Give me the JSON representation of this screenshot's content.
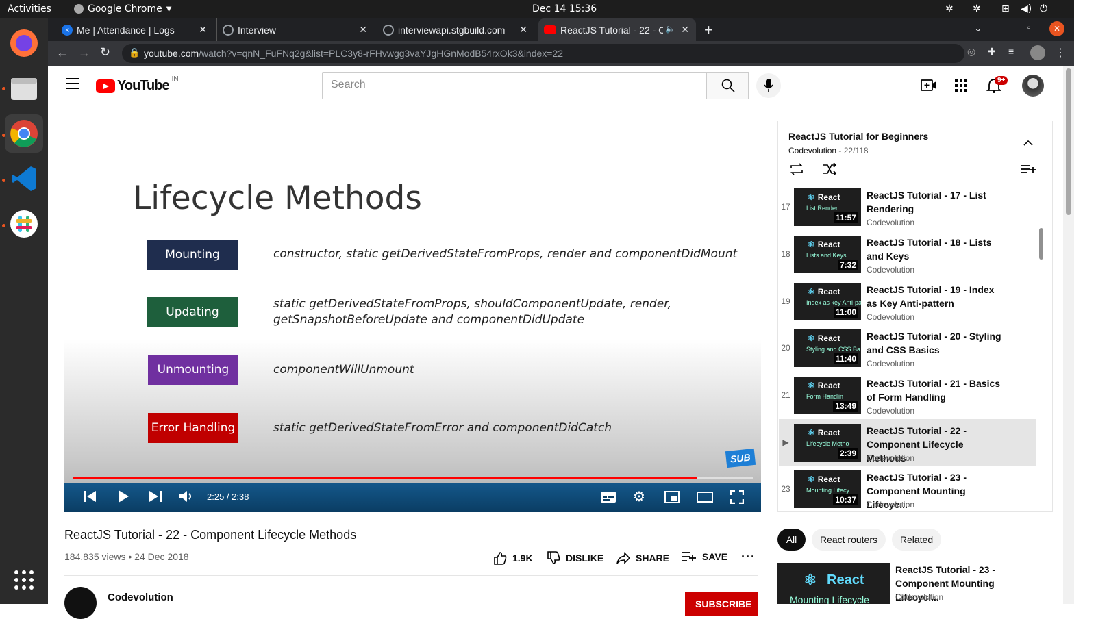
{
  "system": {
    "activities": "Activities",
    "app_name": "Google Chrome",
    "clock": "Dec 14  15:36"
  },
  "tabs": [
    {
      "title": "Me | Attendance | Logs",
      "fav_color": "#1a73e8",
      "fav_letter": "k"
    },
    {
      "title": "Interview",
      "fav_color": "#5f6368",
      "fav_letter": ""
    },
    {
      "title": "interviewapi.stgbuild.com",
      "fav_color": "#5f6368",
      "fav_letter": ""
    },
    {
      "title": "ReactJS Tutorial - 22 - C",
      "fav_color": "#ff0000",
      "fav_letter": ""
    }
  ],
  "address": {
    "domain": "youtube.com",
    "path": "/watch?v=qnN_FuFNq2g&list=PLC3y8-rFHvwgg3vaYJgHGnModB54rxOk3&index=22"
  },
  "masthead": {
    "logo_text": "YouTube",
    "region": "IN",
    "search_placeholder": "Search",
    "notif_count": "9+"
  },
  "slide": {
    "title": "Lifecycle Methods",
    "rows": [
      {
        "label": "Mounting",
        "color": "#1f2d4e",
        "desc_line1": "constructor, static getDerivedStateFromProps, render and componentDidMount",
        "desc_line2": ""
      },
      {
        "label": "Updating",
        "color": "#1e5f3c",
        "desc_line1": "static getDerivedStateFromProps, shouldComponentUpdate, render,",
        "desc_line2": "getSnapshotBeforeUpdate and componentDidUpdate"
      },
      {
        "label": "Unmounting",
        "color": "#7030a0",
        "desc_line1": "componentWillUnmount",
        "desc_line2": ""
      },
      {
        "label": "Error Handling",
        "color": "#c00000",
        "desc_line1": "static getDerivedStateFromError and componentDidCatch",
        "desc_line2": ""
      }
    ],
    "sub_badge": "SUB"
  },
  "player": {
    "time": "2:25 / 2:38",
    "progress": 0.917
  },
  "video": {
    "title": "ReactJS Tutorial - 22 - Component Lifecycle Methods",
    "meta": "184,835 views • 24 Dec 2018",
    "likes": "1.9K",
    "dislike": "DISLIKE",
    "share": "SHARE",
    "save": "SAVE",
    "channel": "Codevolution",
    "subscribe": "SUBSCRIBE"
  },
  "playlist": {
    "title": "ReactJS Tutorial for Beginners",
    "channel": "Codevolution",
    "position": "22/118",
    "items": [
      {
        "num": "17",
        "title": "ReactJS Tutorial - 17 - List Rendering",
        "channel": "Codevolution",
        "duration": "11:57",
        "thumb_sub": "List Render"
      },
      {
        "num": "18",
        "title": "ReactJS Tutorial - 18 - Lists and Keys",
        "channel": "Codevolution",
        "duration": "7:32",
        "thumb_sub": "Lists and Keys"
      },
      {
        "num": "19",
        "title": "ReactJS Tutorial - 19 - Index as Key Anti-pattern",
        "channel": "Codevolution",
        "duration": "11:00",
        "thumb_sub": "Index as key Anti-pa"
      },
      {
        "num": "20",
        "title": "ReactJS Tutorial - 20 - Styling and CSS Basics",
        "channel": "Codevolution",
        "duration": "11:40",
        "thumb_sub": "Styling and CSS Ba"
      },
      {
        "num": "21",
        "title": "ReactJS Tutorial - 21 - Basics of Form Handling",
        "channel": "Codevolution",
        "duration": "13:49",
        "thumb_sub": "Form Handlin"
      },
      {
        "num": "▶",
        "title": "ReactJS Tutorial - 22 - Component Lifecycle Methods",
        "channel": "Codevolution",
        "duration": "2:39",
        "thumb_sub": "Lifecycle Metho"
      },
      {
        "num": "23",
        "title": "ReactJS Tutorial - 23 - Component Mounting Lifecyc...",
        "channel": "Codevolution",
        "duration": "10:37",
        "thumb_sub": "Mounting Lifecy"
      }
    ]
  },
  "chips": [
    "All",
    "React routers",
    "Related"
  ],
  "related": {
    "title": "ReactJS Tutorial - 23 - Component Mounting Lifecycl...",
    "channel": "Codevolution",
    "thumb_logo": "React",
    "thumb_sub": "Mounting Lifecycle"
  }
}
